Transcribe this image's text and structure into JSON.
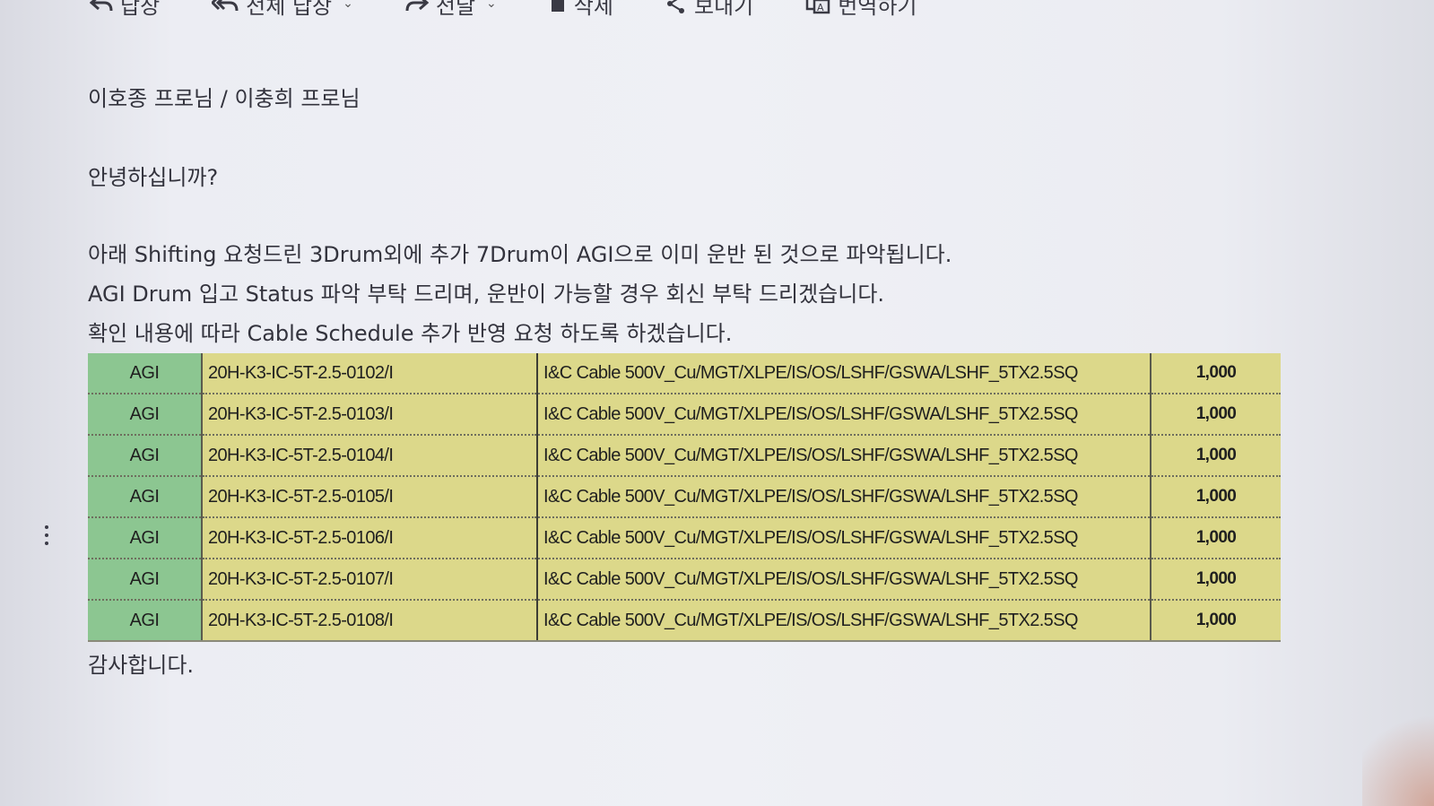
{
  "toolbar": {
    "items": [
      {
        "label": "답장",
        "icon": "reply-icon"
      },
      {
        "label": "전체 답장",
        "icon": "reply-all-icon"
      },
      {
        "label": "전달",
        "icon": "forward-icon"
      },
      {
        "label": "삭제",
        "icon": "trash-icon"
      },
      {
        "label": "보내기",
        "icon": "share-icon"
      },
      {
        "label": "번역하기",
        "icon": "translate-icon"
      }
    ]
  },
  "email": {
    "recipients": "이호종 프로님 / 이충희 프로님",
    "greeting": "안녕하십니까?",
    "body_lines": [
      "아래 Shifting 요청드린 3Drum외에 추가 7Drum이 AGI으로 이미 운반 된 것으로 파악됩니다.",
      "AGI Drum 입고 Status 파악 부탁 드리며, 운반이 가능할 경우 회신 부탁 드리겠습니다.",
      "확인 내용에 따라 Cable Schedule 추가 반영 요청 하도록 하겠습니다."
    ],
    "table_rows": [
      {
        "location": "AGI",
        "tag": "20H-K3-IC-5T-2.5-0102/I",
        "description": "I&C Cable 500V_Cu/MGT/XLPE/IS/OS/LSHF/GSWA/LSHF_5TX2.5SQ",
        "quantity": "1,000"
      },
      {
        "location": "AGI",
        "tag": "20H-K3-IC-5T-2.5-0103/I",
        "description": "I&C Cable 500V_Cu/MGT/XLPE/IS/OS/LSHF/GSWA/LSHF_5TX2.5SQ",
        "quantity": "1,000"
      },
      {
        "location": "AGI",
        "tag": "20H-K3-IC-5T-2.5-0104/I",
        "description": "I&C Cable 500V_Cu/MGT/XLPE/IS/OS/LSHF/GSWA/LSHF_5TX2.5SQ",
        "quantity": "1,000"
      },
      {
        "location": "AGI",
        "tag": "20H-K3-IC-5T-2.5-0105/I",
        "description": "I&C Cable 500V_Cu/MGT/XLPE/IS/OS/LSHF/GSWA/LSHF_5TX2.5SQ",
        "quantity": "1,000"
      },
      {
        "location": "AGI",
        "tag": "20H-K3-IC-5T-2.5-0106/I",
        "description": "I&C Cable 500V_Cu/MGT/XLPE/IS/OS/LSHF/GSWA/LSHF_5TX2.5SQ",
        "quantity": "1,000"
      },
      {
        "location": "AGI",
        "tag": "20H-K3-IC-5T-2.5-0107/I",
        "description": "I&C Cable 500V_Cu/MGT/XLPE/IS/OS/LSHF/GSWA/LSHF_5TX2.5SQ",
        "quantity": "1,000"
      },
      {
        "location": "AGI",
        "tag": "20H-K3-IC-5T-2.5-0108/I",
        "description": "I&C Cable 500V_Cu/MGT/XLPE/IS/OS/LSHF/GSWA/LSHF_5TX2.5SQ",
        "quantity": "1,000"
      }
    ],
    "closing": "감사합니다."
  },
  "colors": {
    "location_cell": "#8cc691",
    "highlight_cell": "#dcd88a"
  }
}
